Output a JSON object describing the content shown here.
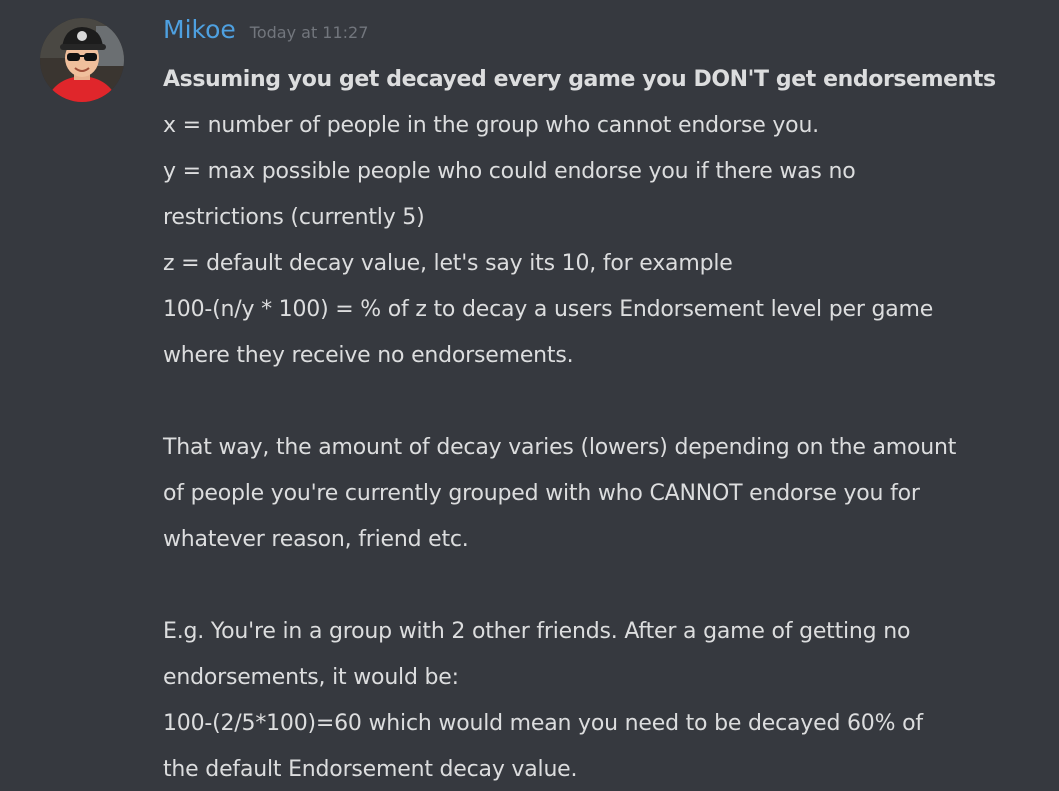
{
  "message": {
    "author": "Mikoe",
    "timestamp": "Today at 11:27",
    "avatar_icon": "user-avatar",
    "username_color": "#4ea0e0",
    "lines": [
      "Assuming you get decayed every game you DON'T get endorsements",
      "x = number of people in the group who cannot endorse you.",
      "y = max possible people who could endorse you if there was no",
      "restrictions (currently 5)",
      "z = default decay value, let's say its 10, for example",
      "100-(n/y * 100) =  % of z to decay a users Endorsement level per game",
      "where they receive no endorsements.",
      "That way, the amount of decay varies (lowers) depending on the amount",
      "of people you're currently grouped with who CANNOT endorse you for",
      "whatever reason, friend etc.",
      "E.g. You're in a group with 2 other friends. After a game of getting no",
      "endorsements, it would be:",
      "100-(2/5*100)=60 which would mean you need to be decayed 60% of",
      "the default Endorsement decay value."
    ]
  }
}
